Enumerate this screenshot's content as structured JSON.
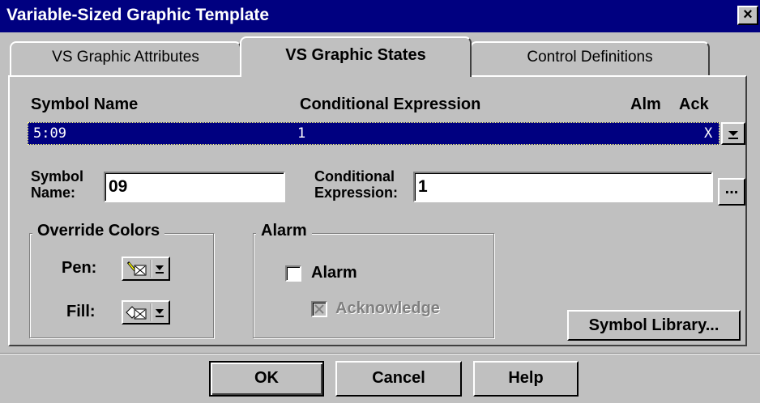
{
  "window": {
    "title": "Variable-Sized Graphic Template",
    "close": "×"
  },
  "tabs": [
    {
      "label": "VS Graphic Attributes"
    },
    {
      "label": "VS Graphic States"
    },
    {
      "label": "Control Definitions"
    }
  ],
  "states": {
    "headers": {
      "symbol_name": "Symbol Name",
      "conditional_expression": "Conditional Expression",
      "alm": "Alm",
      "ack": "Ack"
    },
    "selected_row": {
      "symbol_name": "5:09",
      "conditional_expression": "1",
      "ack": "X"
    }
  },
  "form": {
    "symbol_name_label_1": "Symbol",
    "symbol_name_label_2": "Name:",
    "symbol_name_value": "09",
    "cond_expr_label_1": "Conditional",
    "cond_expr_label_2": "Expression:",
    "cond_expr_value": "1",
    "ellipsis": "..."
  },
  "override_colors": {
    "title": "Override Colors",
    "pen_label": "Pen:",
    "fill_label": "Fill:"
  },
  "alarm": {
    "title": "Alarm",
    "alarm_label": "Alarm",
    "acknowledge_label": "Acknowledge",
    "alarm_checked": false,
    "acknowledge_checked": true
  },
  "buttons": {
    "symbol_library": "Symbol Library...",
    "ok": "OK",
    "cancel": "Cancel",
    "help": "Help"
  },
  "colors": {
    "titlebar": "#000080",
    "face": "#c0c0c0",
    "selection": "#000080"
  }
}
